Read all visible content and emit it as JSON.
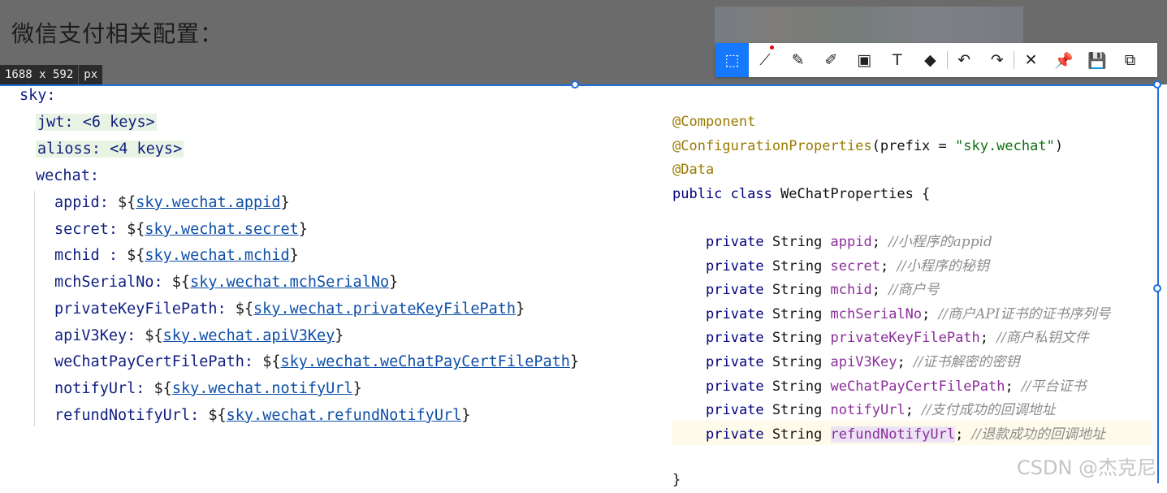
{
  "heading": "微信支付相关配置：",
  "size_label": {
    "dims": "1688 x 592",
    "unit": "px"
  },
  "toolbar": {
    "tools": [
      {
        "name": "shape-tool",
        "glyph": "⬚",
        "active": true
      },
      {
        "name": "line-tool",
        "glyph": "⟋"
      },
      {
        "name": "pen-tool",
        "glyph": "✎"
      },
      {
        "name": "highlighter-tool",
        "glyph": "✐"
      },
      {
        "name": "mosaic-tool",
        "glyph": "▣"
      },
      {
        "name": "text-tool",
        "glyph": "T"
      },
      {
        "name": "eraser-tool",
        "glyph": "◆"
      },
      {
        "name": "undo-button",
        "glyph": "↶"
      },
      {
        "name": "redo-button",
        "glyph": "↷"
      },
      {
        "name": "close-button",
        "glyph": "✕"
      },
      {
        "name": "pin-button",
        "glyph": "📌"
      },
      {
        "name": "save-button",
        "glyph": "💾"
      },
      {
        "name": "copy-button",
        "glyph": "⧉"
      }
    ]
  },
  "yaml": {
    "root": "sky:",
    "jwt": "jwt: <6 keys>",
    "alioss": "alioss: <4 keys>",
    "wechat": "wechat:",
    "entries": [
      {
        "key": "appid: ",
        "ref": "sky.wechat.appid"
      },
      {
        "key": "secret: ",
        "ref": "sky.wechat.secret"
      },
      {
        "key": "mchid : ",
        "ref": "sky.wechat.mchid"
      },
      {
        "key": "mchSerialNo: ",
        "ref": "sky.wechat.mchSerialNo"
      },
      {
        "key": "privateKeyFilePath: ",
        "ref": "sky.wechat.privateKeyFilePath"
      },
      {
        "key": "apiV3Key: ",
        "ref": "sky.wechat.apiV3Key"
      },
      {
        "key": "weChatPayCertFilePath: ",
        "ref": "sky.wechat.weChatPayCertFilePath"
      },
      {
        "key": "notifyUrl: ",
        "ref": "sky.wechat.notifyUrl"
      },
      {
        "key": "refundNotifyUrl: ",
        "ref": "sky.wechat.refundNotifyUrl"
      }
    ]
  },
  "java": {
    "annotation_component": "@Component",
    "annotation_config": "@ConfigurationProperties",
    "prefix_open": "(prefix = ",
    "prefix_value": "\"sky.wechat\"",
    "prefix_close": ")",
    "annotation_data": "@Data",
    "class_decl_kw": "public class ",
    "class_decl_name": "WeChatProperties {",
    "field_kw": "private ",
    "field_type": "String ",
    "fields": [
      {
        "name": "appid",
        "comment": "//小程序的appid"
      },
      {
        "name": "secret",
        "comment": "//小程序的秘钥"
      },
      {
        "name": "mchid",
        "comment": "//商户号"
      },
      {
        "name": "mchSerialNo",
        "comment": "//商户API证书的证书序列号"
      },
      {
        "name": "privateKeyFilePath",
        "comment": "//商户私钥文件"
      },
      {
        "name": "apiV3Key",
        "comment": "//证书解密的密钥"
      },
      {
        "name": "weChatPayCertFilePath",
        "comment": "//平台证书"
      },
      {
        "name": "notifyUrl",
        "comment": "//支付成功的回调地址"
      },
      {
        "name": "refundNotifyUrl",
        "comment": "//退款成功的回调地址"
      }
    ],
    "closing_brace": "}"
  },
  "watermark": "CSDN @杰克尼",
  "colors": {
    "selection": "#1e6fe0",
    "toolbar_active": "#1677ff"
  }
}
